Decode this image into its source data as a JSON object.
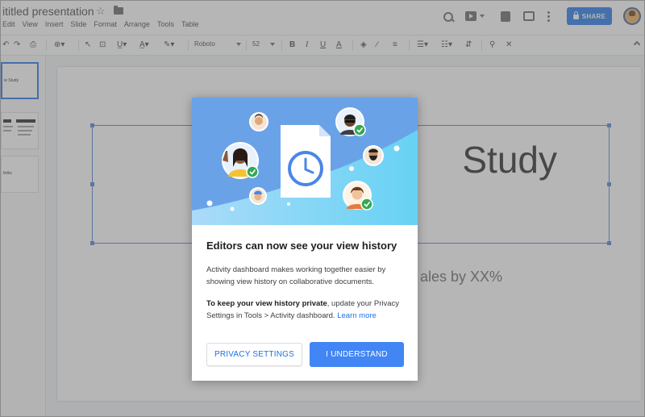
{
  "header": {
    "doc_title": "ititled presentation",
    "menu": [
      "Edit",
      "View",
      "Insert",
      "Slide",
      "Format",
      "Arrange",
      "Tools",
      "Table"
    ],
    "share_label": "SHARE"
  },
  "toolbar": {
    "font": "Roboto",
    "size": "52"
  },
  "filmstrip": {
    "thumb1_text": "ie Study",
    "thumb3_text": "ttribs"
  },
  "slide": {
    "title": "Study",
    "subtitle": "ales by XX%"
  },
  "modal": {
    "title": "Editors can now see your view history",
    "body1": "Activity dashboard makes working together easier by showing view history on collaborative documents.",
    "body2_bold": "To keep your view history private",
    "body2_rest": ", update your Privacy Settings in Tools > Activity dashboard. ",
    "learn_more": "Learn more",
    "privacy_button": "PRIVACY SETTINGS",
    "understand_button": "I UNDERSTAND"
  },
  "colors": {
    "accent": "#1a73e8",
    "primary_button": "#4285f4",
    "hero_bg": "#6aa2e8",
    "check_green": "#34a853"
  },
  "icons": [
    "star-icon",
    "folder-icon",
    "search-icon",
    "present-icon",
    "comment-history-icon",
    "comments-icon",
    "more-icon",
    "lock-icon",
    "clock-document-icon",
    "check-icon"
  ]
}
